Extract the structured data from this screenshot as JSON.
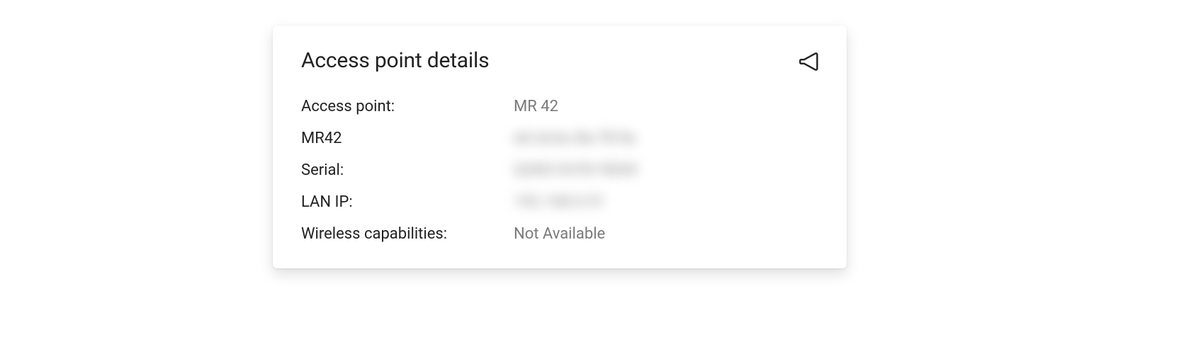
{
  "card": {
    "title": "Access point details",
    "rows": [
      {
        "label": "Access point:",
        "value": "MR 42",
        "blurred": false
      },
      {
        "label": "MR42",
        "value": "e0:cb:bc:8a:78:9a",
        "blurred": true
      },
      {
        "label": "Serial:",
        "value": "Q2KD-GV5V-9D69",
        "blurred": true
      },
      {
        "label": "LAN IP:",
        "value": "192.168.0.51",
        "blurred": true
      },
      {
        "label": "Wireless capabilities:",
        "value": "Not Available",
        "blurred": false
      }
    ]
  }
}
